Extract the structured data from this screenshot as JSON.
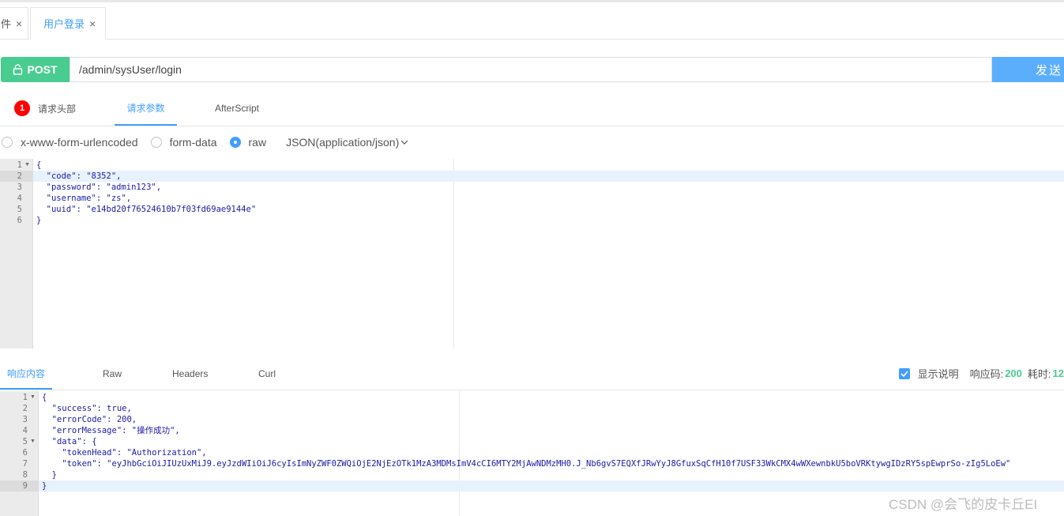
{
  "tabs": [
    {
      "label": "件",
      "close": "×"
    },
    {
      "label": "用户登录",
      "close": "×"
    }
  ],
  "request": {
    "method": "POST",
    "url": "/admin/sysUser/login",
    "send_label": "发送"
  },
  "request_tabs": [
    {
      "label": "请求头部",
      "badge": "1"
    },
    {
      "label": "请求参数"
    },
    {
      "label": "AfterScript"
    }
  ],
  "body_types": [
    {
      "label": "x-www-form-urlencoded",
      "checked": false
    },
    {
      "label": "form-data",
      "checked": false
    },
    {
      "label": "raw",
      "checked": true
    }
  ],
  "content_type": "JSON(application/json)",
  "request_body": {
    "line_numbers": [
      "1",
      "2",
      "3",
      "4",
      "5",
      "6"
    ],
    "lines": [
      "{",
      "  \"code\": \"8352\",",
      "  \"password\": \"admin123\",",
      "  \"username\": \"zs\",",
      "  \"uuid\": \"e14bd20f76524610b7f03fd69ae9144e\"",
      "}"
    ]
  },
  "response_tabs": [
    {
      "label": "响应内容"
    },
    {
      "label": "Raw"
    },
    {
      "label": "Headers"
    },
    {
      "label": "Curl"
    }
  ],
  "response_meta": {
    "show_desc_label": "显示说明",
    "status_label": "响应码:",
    "status_code": "200",
    "time_label": "耗时:",
    "time_value": "12"
  },
  "response_body": {
    "line_numbers": [
      "1",
      "2",
      "3",
      "4",
      "5",
      "6",
      "7",
      "8",
      "9"
    ],
    "lines": [
      "{",
      "  \"success\": true,",
      "  \"errorCode\": 200,",
      "  \"errorMessage\": \"操作成功\",",
      "  \"data\": {",
      "    \"tokenHead\": \"Authorization\",",
      "    \"token\": \"eyJhbGciOiJIUzUxMiJ9.eyJzdWIiOiJ6cyIsImNyZWF0ZWQiOjE2NjEzOTk1MzA3MDMsImV4cCI6MTY2MjAwNDMzMH0.J_Nb6gvS7EQXfJRwYyJ8GfuxSqCfH10f7USF33WkCMX4wWXewnbkU5boVRKtywgIDzRY5spEwprSo-zIg5LoEw\"",
      "  }",
      "}"
    ]
  },
  "watermark": "CSDN @会飞的皮卡丘EI",
  "colors": {
    "accent": "#409eff",
    "method": "#49cc90",
    "send": "#5aaefc",
    "badge": "#ff0000"
  }
}
